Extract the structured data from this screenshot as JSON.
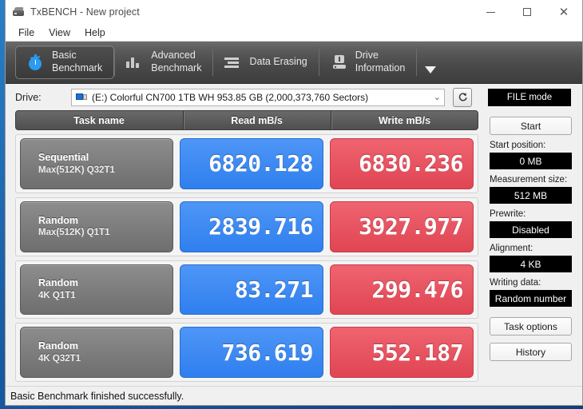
{
  "window": {
    "title": "TxBENCH - New project",
    "app_icon": "drive-icon",
    "controls": {
      "minimize": "minimize-icon",
      "maximize": "maximize-icon",
      "close": "close-icon"
    }
  },
  "menubar": {
    "items": [
      "File",
      "View",
      "Help"
    ]
  },
  "tabs": [
    {
      "label": "Basic\nBenchmark",
      "icon": "stopwatch-icon",
      "active": true
    },
    {
      "label": "Advanced\nBenchmark",
      "icon": "bar-chart-icon",
      "active": false
    },
    {
      "label": "Data Erasing",
      "icon": "eraser-icon",
      "active": false
    },
    {
      "label": "Drive\nInformation",
      "icon": "drive-info-icon",
      "active": false
    }
  ],
  "tabs_overflow_icon": "chevron-down-icon",
  "drive": {
    "label": "Drive:",
    "selected": "(E:) Colorful CN700 1TB WH  953.85 GB (2,000,373,760 Sectors)",
    "dropdown_icon": "chevron-down-icon",
    "refresh_icon": "refresh-icon",
    "mode_button": "FILE mode"
  },
  "table": {
    "headers": [
      "Task name",
      "Read mB/s",
      "Write mB/s"
    ],
    "rows": [
      {
        "name_line1": "Sequential",
        "name_line2": "Max(512K) Q32T1",
        "read": "6820.128",
        "write": "6830.236"
      },
      {
        "name_line1": "Random",
        "name_line2": "Max(512K) Q1T1",
        "read": "2839.716",
        "write": "3927.977"
      },
      {
        "name_line1": "Random",
        "name_line2": "4K Q1T1",
        "read": "83.271",
        "write": "299.476"
      },
      {
        "name_line1": "Random",
        "name_line2": "4K Q32T1",
        "read": "736.619",
        "write": "552.187"
      }
    ]
  },
  "sidebar": {
    "start_button": "Start",
    "fields": [
      {
        "label": "Start position:",
        "value": "0 MB"
      },
      {
        "label": "Measurement size:",
        "value": "512 MB"
      },
      {
        "label": "Prewrite:",
        "value": "Disabled"
      },
      {
        "label": "Alignment:",
        "value": "4 KB"
      },
      {
        "label": "Writing data:",
        "value": "Random number"
      }
    ],
    "task_options_button": "Task options",
    "history_button": "History"
  },
  "statusbar": {
    "text": "Basic Benchmark finished successfully."
  },
  "colors": {
    "read_blue": "#3b8cf5",
    "write_red": "#e8515e",
    "tab_dark": "#4a4a4a",
    "accent_icon_blue": "#2a9bf0"
  }
}
